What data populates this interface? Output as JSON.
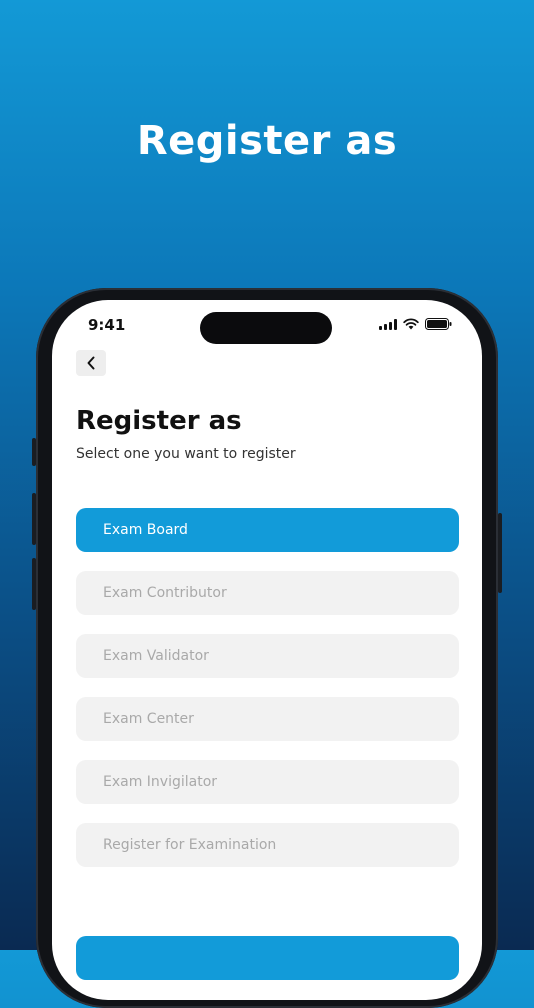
{
  "headline": "Register as",
  "status_bar": {
    "time": "9:41"
  },
  "page": {
    "title": "Register as",
    "subtitle": "Select one you want to register"
  },
  "options": [
    {
      "label": "Exam Board",
      "selected": true
    },
    {
      "label": "Exam Contributor",
      "selected": false
    },
    {
      "label": "Exam Validator",
      "selected": false
    },
    {
      "label": "Exam Center",
      "selected": false
    },
    {
      "label": "Exam Invigilator",
      "selected": false
    },
    {
      "label": "Register for Examination",
      "selected": false
    }
  ],
  "colors": {
    "accent": "#129bd9",
    "option_bg": "#f2f2f2",
    "option_text": "#a9a9a9"
  }
}
